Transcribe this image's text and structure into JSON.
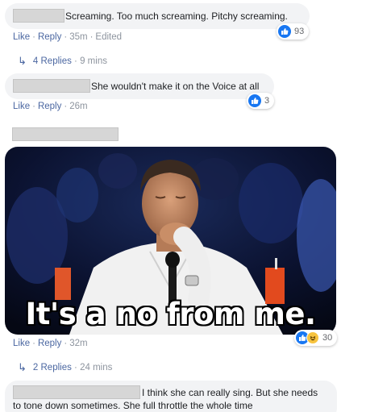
{
  "comments": [
    {
      "text": "Screaming. Too much screaming. Pitchy screaming.",
      "like_label": "Like",
      "reply_label": "Reply",
      "time": "35m",
      "edited_label": "Edited",
      "reaction_count": "93",
      "replies_label": "4 Replies",
      "replies_time": "9 mins"
    },
    {
      "text": "She wouldn't make it on the Voice at all",
      "like_label": "Like",
      "reply_label": "Reply",
      "time": "26m",
      "reaction_count": "3"
    },
    {
      "gif_caption": "It's a no from me.",
      "like_label": "Like",
      "reply_label": "Reply",
      "time": "32m",
      "reaction_count": "30",
      "replies_label": "2 Replies",
      "replies_time": "24 mins"
    },
    {
      "text_line1": "I think she can really sing. But she needs",
      "text_line2": "to tone down sometimes. She full throttle the whole time"
    }
  ],
  "colors": {
    "link": "#4b67a1",
    "meta": "#8d949e",
    "bubble": "#f2f3f5",
    "like_blue": "#1877f2",
    "haha_yellow": "#f7c33e"
  },
  "icons": {
    "like": "thumbs-up-icon",
    "haha": "laughing-face-icon",
    "reply_arrow": "reply-arrow-icon"
  }
}
